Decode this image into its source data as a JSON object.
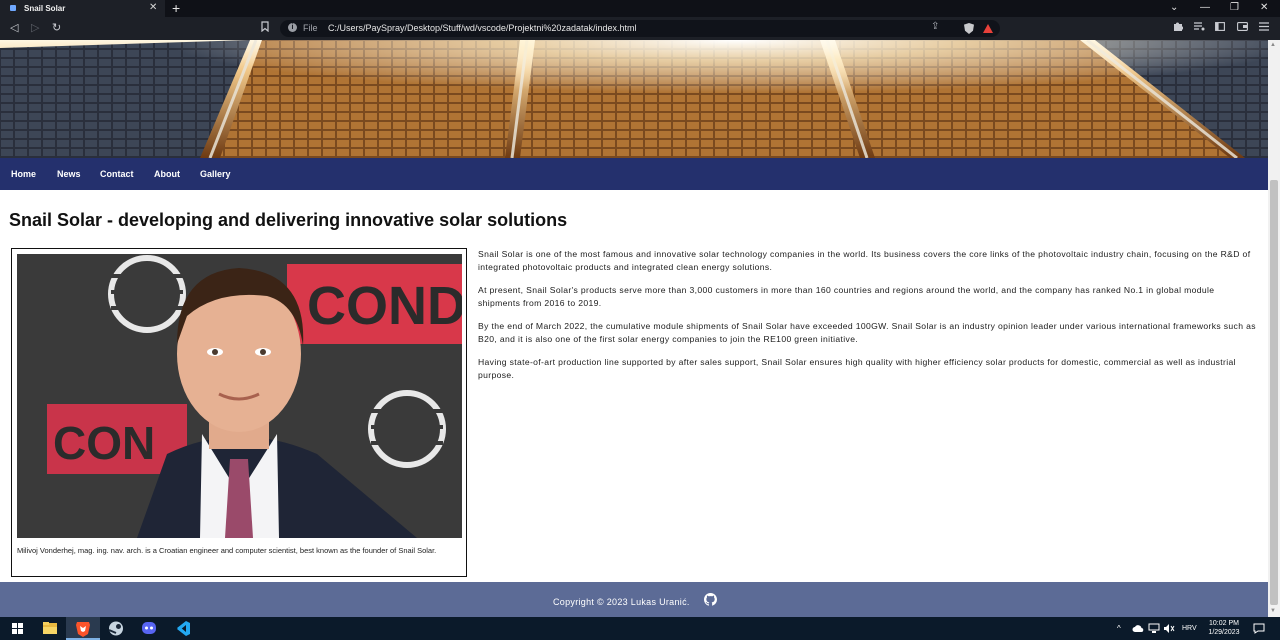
{
  "browser": {
    "tab_title": "Snail Solar",
    "tab_close": "✕",
    "new_tab": "+",
    "window_controls": [
      "⌄",
      "—",
      "❐",
      "✕"
    ],
    "nav_buttons": [
      "◁",
      "▷",
      "↻"
    ],
    "address": {
      "scheme_label": "File",
      "url": "C:/Users/PaySpray/Desktop/Stuff/wd/vscode/Projektni%20zadatak/index.html"
    },
    "toolbar_icons": [
      "bookmark-icon",
      "share-icon",
      "brave-shield-icon",
      "brave-rewards-icon",
      "extensions-icon",
      "playlist-icon",
      "sidebar-icon",
      "wallet-icon",
      "menu-icon"
    ]
  },
  "site": {
    "nav": [
      {
        "label": "Home"
      },
      {
        "label": "News"
      },
      {
        "label": "Contact"
      },
      {
        "label": "About"
      },
      {
        "label": "Gallery"
      }
    ],
    "title": "Snail Solar - developing and delivering innovative solar solutions",
    "figure_caption": "Milivoj Vonderhej, mag. ing. nav. arch. is a Croatian engineer and computer scientist, best known as the founder of Snail Solar.",
    "paragraphs": [
      "Snail Solar is one of the most famous and innovative solar technology companies in the world. Its business covers the core links of the photovoltaic industry chain, focusing on the R&D of integrated photovoltaic products and integrated clean energy solutions.",
      "At present, Snail Solar's products serve more than 3,000 customers in more than 160 countries and regions around the world, and the company has ranked No.1 in global module shipments from 2016 to 2019.",
      "By the end of March 2022, the cumulative module shipments of Snail Solar have exceeded 100GW. Snail Solar is an industry opinion leader under various international frameworks such as B20, and it is also one of the first solar energy companies to join the RE100 green initiative.",
      "Having state-of-art production line supported by after sales support, Snail Solar ensures high quality with higher efficiency solar products for domestic, commercial as well as industrial purpose."
    ],
    "footer": "Copyright © 2023 Lukas Uranić."
  },
  "taskbar": {
    "language": "HRV",
    "time": "10:02 PM",
    "date": "1/29/2023"
  },
  "colors": {
    "navbar": "#24306d",
    "footer": "#5c6b96",
    "taskbar": "#0b1a2a"
  }
}
